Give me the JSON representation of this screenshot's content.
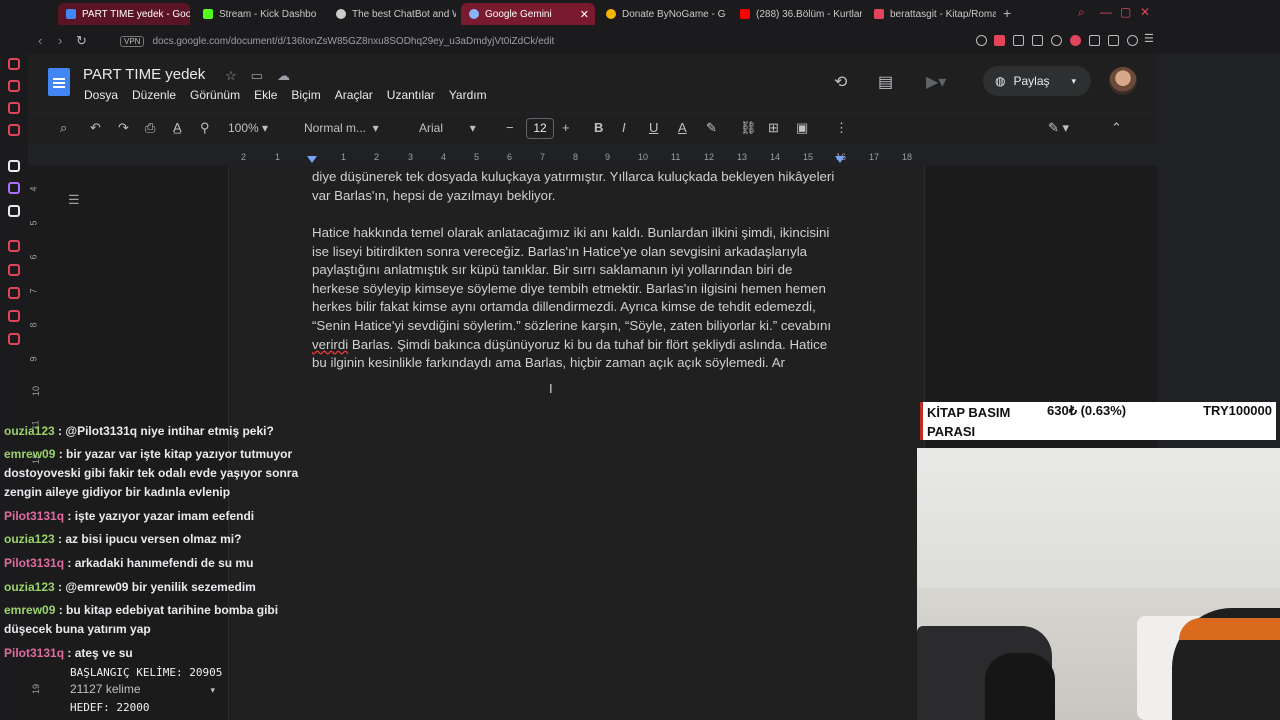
{
  "browser": {
    "tabs": [
      {
        "label": "PART TIME yedek - Goog",
        "active": false,
        "color": "#7a1a2e"
      },
      {
        "label": "Stream - Kick Dashbo",
        "active": false,
        "color": "#53fc18"
      },
      {
        "label": "The best ChatBot and W",
        "active": false,
        "color": "#cccccc"
      },
      {
        "label": "Google Gemini",
        "active": true,
        "color": "#7a1a2e"
      },
      {
        "label": "Donate ByNoGame - Gele",
        "active": false,
        "color": "#f4b400"
      },
      {
        "label": "(288) 36.Bölüm - Kurtlar",
        "active": false,
        "color": "#ff0000"
      },
      {
        "label": "berattasgit - Kitap/Roman",
        "active": false,
        "color": "#e2455a"
      }
    ],
    "close_glyph": "✕",
    "new_tab_glyph": "+",
    "vpn_label": "VPN",
    "url": "docs.google.com/document/d/136tonZsW85GZ8nxu8SODhq29ey_u3aDmdyjVt0iZdCk/edit"
  },
  "docs": {
    "title": "PART TIME  yedek",
    "menu": [
      "Dosya",
      "Düzenle",
      "Görünüm",
      "Ekle",
      "Biçim",
      "Araçlar",
      "Uzantılar",
      "Yardım"
    ],
    "share_label": "Paylaş",
    "toolbar": {
      "zoom": "100%",
      "style": "Normal m...",
      "font": "Arial",
      "font_size": "12"
    },
    "ruler_numbers": [
      "2",
      "1",
      "1",
      "2",
      "3",
      "4",
      "5",
      "6",
      "7",
      "8",
      "9",
      "10",
      "11",
      "12",
      "13",
      "14",
      "15",
      "16",
      "17",
      "18"
    ],
    "vruler_numbers": [
      "4",
      "5",
      "6",
      "7",
      "8",
      "9",
      "10",
      "11",
      "12",
      "19"
    ],
    "paragraphs": {
      "p1": "diye düşünerek tek dosyada kuluçkaya yatırmıştır. Yıllarca kuluçkada bekleyen hikâyeleri var Barlas'ın, hepsi de yazılmayı bekliyor.",
      "p2_before": "Hatice hakkında temel olarak anlatacağımız iki anı kaldı. Bunlardan ilkini şimdi, ikincisini ise liseyi bitirdikten sonra vereceğiz. Barlas'ın Hatice'ye olan sevgisini arkadaşlarıyla paylaştığını anlatmıştık sır küpü tanıklar. Bir sırrı saklamanın iyi yollarından biri de herkese söyleyip kimseye söyleme diye tembih etmektir. Barlas'ın ilgisini hemen hemen herkes bilir fakat kimse aynı ortamda dillendirmezdi. Ayrıca kimse de tehdit edemezdi, “Senin Hatice'yi sevdiğini söylerim.” sözlerine karşın, “Söyle, zaten biliyorlar ki.” cevabını ",
      "p2_misspelled": "verirdi",
      "p2_after": " Barlas. Şimdi bakınca düşünüyoruz ki bu da tuhaf bir flört şekliydi aslında. Hatice bu ilginin kesinlikle farkındaydı ama Barlas, hiçbir zaman açık açık söylemedi. Ar"
    },
    "word_count": "21127 kelime"
  },
  "chat": [
    {
      "user": "ouzia123",
      "text": " : @Pilot3131q niye intihar etmiş peki?",
      "color": "#9bd36a"
    },
    {
      "user": "emrew09",
      "text": " : bir yazar var işte kitap yazıyor tutmuyor dostoyoveski gibi fakir tek odalı evde yaşıyor sonra zengin aileye gidiyor bir kadınla evlenip",
      "color": "#9bd36a"
    },
    {
      "user": "Pilot3131q",
      "text": " : işte yazıyor yazar imam eefendi",
      "color": "#e06c9f"
    },
    {
      "user": "ouzia123",
      "text": " : az bisi ipucu versen olmaz mi?",
      "color": "#9bd36a"
    },
    {
      "user": "Pilot3131q",
      "text": " : arkadaki hanımefendi de su mu",
      "color": "#e06c9f"
    },
    {
      "user": "ouzia123",
      "text": " : @emrew09 bir yenilik sezemedim",
      "color": "#9bd36a"
    },
    {
      "user": "emrew09",
      "text": " : bu kitap edebiyat tarihine bomba gibi düşecek buna yatırım yap",
      "color": "#9bd36a"
    },
    {
      "user": "Pilot3131q",
      "text": " : ateş ve su",
      "color": "#e06c9f"
    }
  ],
  "stats": {
    "start_words": "BAŞLANGIÇ KELİME: 20905",
    "goal": "HEDEF: 22000"
  },
  "donation": {
    "label": "KİTAP BASIM PARASI",
    "amount": "630₺ (0.63%)",
    "goal": "TRY100000"
  },
  "icons": {
    "history": "history-icon",
    "comments": "comment-icon",
    "meet": "video-icon",
    "share": "globe-icon"
  }
}
